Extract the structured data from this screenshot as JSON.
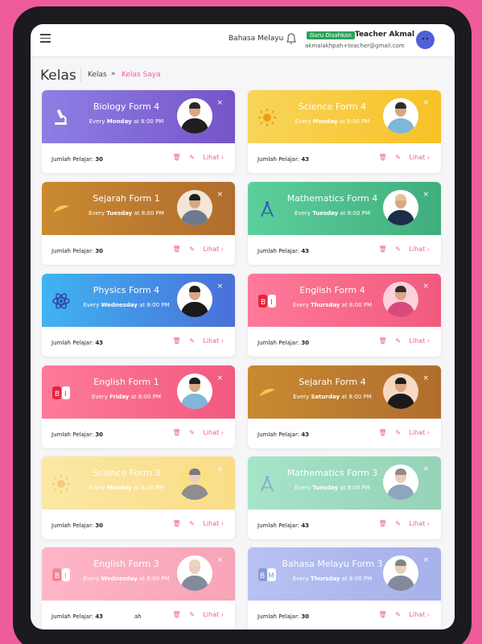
{
  "header": {
    "language": "Bahasa Melayu",
    "verified_badge": "Guru Disahkan",
    "teacher_name": "Teacher Akmal",
    "teacher_email": "akmalakhpah+teacher@gmail.com"
  },
  "page": {
    "title": "Kelas",
    "breadcrumb": [
      "Kelas",
      "Kelas Saya"
    ],
    "breadcrumb_sep": "»"
  },
  "common": {
    "count_label": "Jumlah Pelajar:",
    "view_label": "Lihat",
    "close_symbol": "×"
  },
  "cards": [
    {
      "subject": "Biology Form 4",
      "every": "Every",
      "day": "Monday",
      "at": "at 8:00 PM",
      "students": "30",
      "gradient": "linear-gradient(90deg,#8e7fe4,#7654c7)",
      "icon": "microscope-icon"
    },
    {
      "subject": "Science Form 4",
      "every": "Every",
      "day": "Monday",
      "at": "at 8:00 PM",
      "students": "43",
      "gradient": "linear-gradient(90deg,#f7d55a,#f8c127)",
      "icon": "sun-icon"
    },
    {
      "subject": "Sejarah Form 1",
      "every": "Every",
      "day": "Tuesday",
      "at": "at 8:00 PM",
      "students": "30",
      "gradient": "linear-gradient(90deg,#c98a31,#b06d2e)",
      "icon": "sejarah-icon"
    },
    {
      "subject": "Mathematics Form 4",
      "every": "Every",
      "day": "Tuesday",
      "at": "at 8:00 PM",
      "students": "43",
      "gradient": "linear-gradient(90deg,#5dcf9c,#3fae7c)",
      "icon": "compass-icon"
    },
    {
      "subject": "Physics Form 4",
      "every": "Every",
      "day": "Wednesday",
      "at": "at 8:00 PM",
      "students": "43",
      "gradient": "linear-gradient(90deg,#3fb4f1,#4a6fd9)",
      "icon": "atom-icon"
    },
    {
      "subject": "English Form 4",
      "every": "Every",
      "day": "Thursday",
      "at": "at 8:00 PM",
      "students": "30",
      "gradient": "linear-gradient(90deg,#ff7a9a,#f15a7e)",
      "icon": "bi-icon"
    },
    {
      "subject": "English Form 1",
      "every": "Every",
      "day": "Friday",
      "at": "at 8:00 PM",
      "students": "30",
      "gradient": "linear-gradient(90deg,#ff7a9a,#f15a7e)",
      "icon": "bi-icon"
    },
    {
      "subject": "Sejarah Form 4",
      "every": "Every",
      "day": "Saturday",
      "at": "at 8:00 PM",
      "students": "43",
      "gradient": "linear-gradient(90deg,#c98a31,#b06d2e)",
      "icon": "sejarah-icon"
    },
    {
      "subject": "Science Form 3",
      "every": "Every",
      "day": "Monday",
      "at": "at 8:00 PM",
      "students": "30",
      "gradient": "linear-gradient(90deg,#f7d55a,#f8c127)",
      "icon": "sun-icon",
      "faded": true
    },
    {
      "subject": "Mathematics Form 3",
      "every": "Every",
      "day": "Tuesday",
      "at": "at 8:00 PM",
      "students": "43",
      "gradient": "linear-gradient(90deg,#5dcf9c,#3fae7c)",
      "icon": "compass-icon",
      "faded": true
    },
    {
      "subject": "English Form 3",
      "every": "Every",
      "day": "Wednesday",
      "at": "at 8:00 PM",
      "students": "43",
      "gradient": "linear-gradient(90deg,#ff7a9a,#f15a7e)",
      "icon": "bi-icon",
      "faded": true,
      "extra": "ah"
    },
    {
      "subject": "Bahasa Melayu Form 3",
      "every": "Every",
      "day": "Thursday",
      "at": "at 8:00 PM",
      "students": "30",
      "gradient": "linear-gradient(90deg,#7f8fe8,#5f71d9)",
      "icon": "bm-icon",
      "faded": true
    }
  ]
}
